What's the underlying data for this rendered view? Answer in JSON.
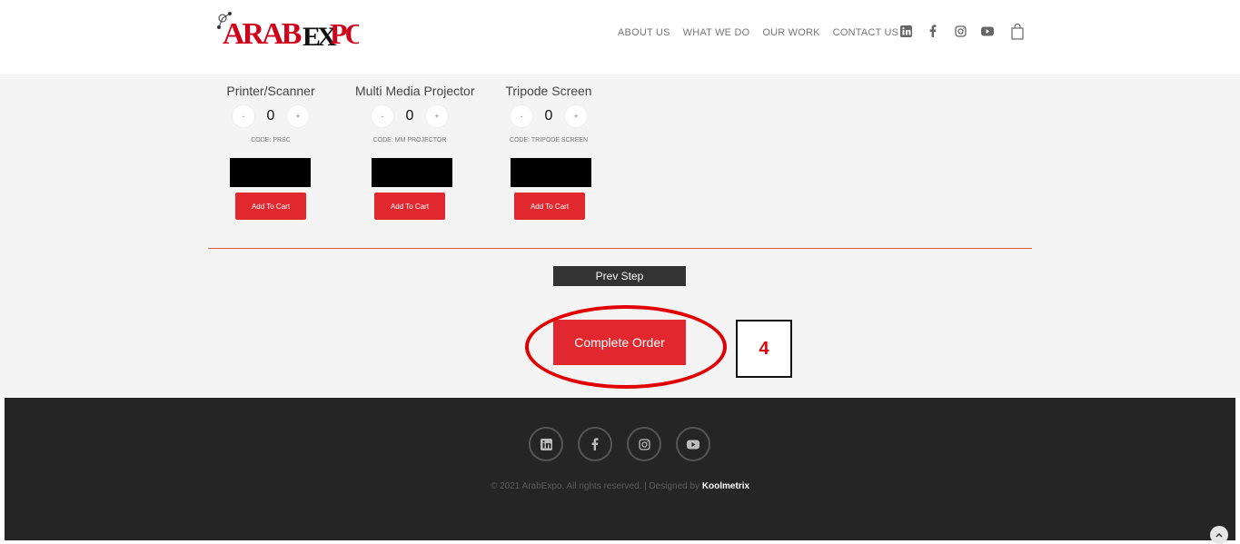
{
  "header": {
    "logo_text": "ARABEXPO",
    "nav": [
      "ABOUT US",
      "WHAT WE DO",
      "OUR WORK",
      "CONTACT US"
    ],
    "social_icons": [
      "linkedin-icon",
      "facebook-icon",
      "instagram-icon",
      "youtube-icon"
    ],
    "cart_icon": "shopping-bag-icon"
  },
  "products": [
    {
      "title": "Printer/Scanner",
      "qty": "0",
      "minus": "-",
      "plus": "+",
      "code": "CODE: PRSC",
      "add_label": "Add To Cart"
    },
    {
      "title": "Multi Media Projector",
      "qty": "0",
      "minus": "-",
      "plus": "+",
      "code": "CODE: MM PROJECTOR",
      "add_label": "Add To Cart"
    },
    {
      "title": "Tripode Screen",
      "qty": "0",
      "minus": "-",
      "plus": "+",
      "code": "CODE: TRIPODE SCREEN",
      "add_label": "Add To Cart"
    }
  ],
  "actions": {
    "prev_label": "Prev Step",
    "complete_label": "Complete Order",
    "step_number": "4"
  },
  "footer": {
    "social_icons": [
      "linkedin-icon",
      "facebook-icon",
      "instagram-icon",
      "youtube-icon"
    ],
    "copyright": "© 2021 ArabExpo. All rights reserved. | Designed by ",
    "designer": "Koolmetrix"
  },
  "colors": {
    "accent_red": "#e0282e",
    "footer_bg": "#252525",
    "content_bg": "#f4f4f4"
  }
}
